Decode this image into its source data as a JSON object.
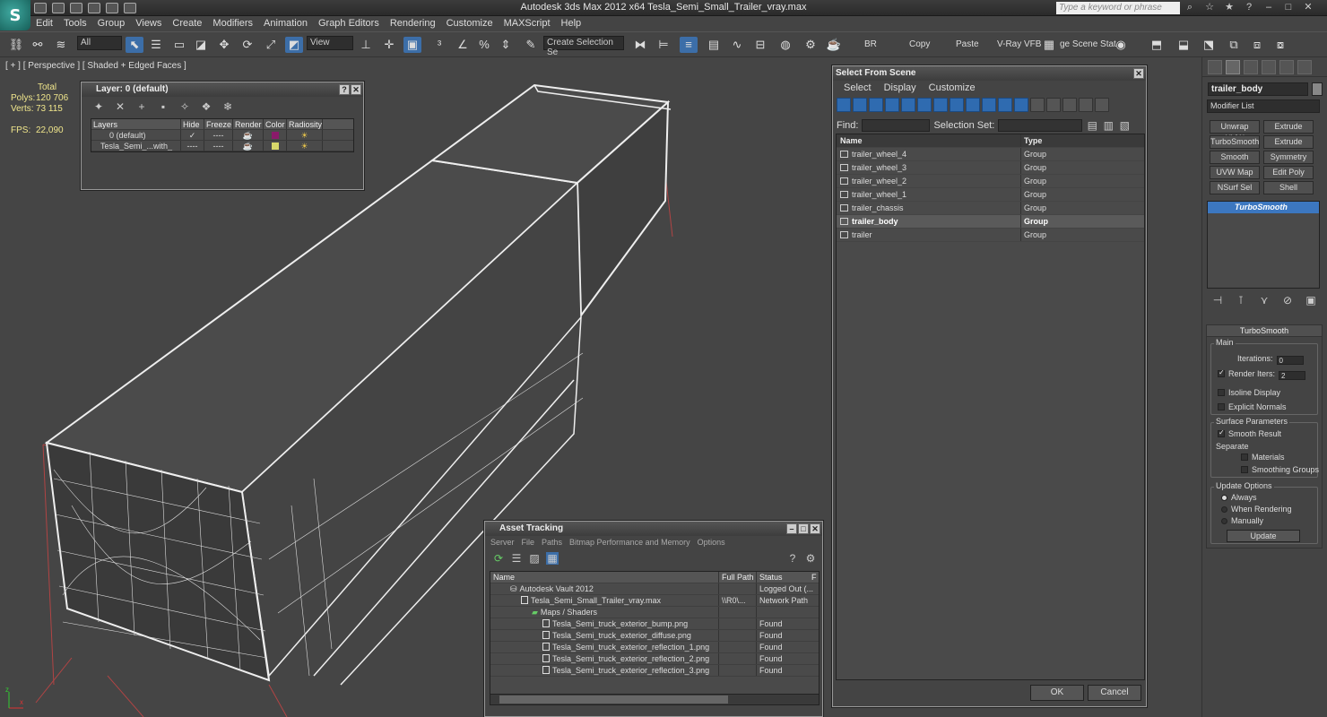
{
  "app": {
    "title": "Autodesk 3ds Max  2012 x64     Tesla_Semi_Small_Trailer_vray.max",
    "search_placeholder": "Type a keyword or phrase",
    "logo_letter": "S"
  },
  "menu": [
    "Edit",
    "Tools",
    "Group",
    "Views",
    "Create",
    "Modifiers",
    "Animation",
    "Graph Editors",
    "Rendering",
    "Customize",
    "MAXScript",
    "Help"
  ],
  "toolbar": {
    "filter": "All",
    "ref_coord": "View",
    "selection_set_placeholder": "Create Selection Se",
    "labels": [
      "BR",
      "Copy",
      "Paste",
      "V-Ray VFB",
      "ge Scene Stat"
    ]
  },
  "viewport": {
    "label": "[ + ] [ Perspective ] [ Shaded + Edged Faces ]",
    "stats": {
      "header": "Total",
      "polys_label": "Polys:",
      "polys": "120 706",
      "verts_label": "Verts:",
      "verts": "73 115",
      "fps_label": "FPS:",
      "fps": "22,090"
    },
    "axis": {
      "x": "x",
      "y": "y",
      "z": "z"
    }
  },
  "layer_panel": {
    "title": "Layer: 0 (default)",
    "columns": [
      "Layers",
      "Hide",
      "Freeze",
      "Render",
      "Color",
      "Radiosity"
    ],
    "rows": [
      {
        "name": "0 (default)",
        "hide": "----",
        "freeze": "----",
        "color": "#8a1a6a"
      },
      {
        "name": "Tesla_Semi_...with_",
        "hide": "----",
        "freeze": "----",
        "color": "#d8d86a"
      }
    ]
  },
  "select_from_scene": {
    "title": "Select From Scene",
    "menu": [
      "Select",
      "Display",
      "Customize"
    ],
    "find_label": "Find:",
    "selection_set_label": "Selection Set:",
    "columns": [
      "Name",
      "Type"
    ],
    "rows": [
      {
        "name": "trailer_wheel_4",
        "type": "Group",
        "selected": false
      },
      {
        "name": "trailer_wheel_3",
        "type": "Group",
        "selected": false
      },
      {
        "name": "trailer_wheel_2",
        "type": "Group",
        "selected": false
      },
      {
        "name": "trailer_wheel_1",
        "type": "Group",
        "selected": false
      },
      {
        "name": "trailer_chassis",
        "type": "Group",
        "selected": false
      },
      {
        "name": "trailer_body",
        "type": "Group",
        "selected": true
      },
      {
        "name": "trailer",
        "type": "Group",
        "selected": false
      }
    ],
    "ok": "OK",
    "cancel": "Cancel"
  },
  "asset_tracking": {
    "title": "Asset Tracking",
    "menu": [
      "Server",
      "File",
      "Paths",
      "Bitmap Performance and Memory",
      "Options"
    ],
    "columns": [
      "Name",
      "Full Path",
      "Status",
      "F"
    ],
    "rows": [
      {
        "indent": 1,
        "name": "Autodesk Vault 2012",
        "path": "",
        "status": "Logged Out (..."
      },
      {
        "indent": 2,
        "name": "Tesla_Semi_Small_Trailer_vray.max",
        "path": "\\\\R0\\...",
        "status": "Network Path"
      },
      {
        "indent": 3,
        "name": "Maps / Shaders",
        "path": "",
        "status": ""
      },
      {
        "indent": 4,
        "name": "Tesla_Semi_truck_exterior_bump.png",
        "path": "",
        "status": "Found"
      },
      {
        "indent": 4,
        "name": "Tesla_Semi_truck_exterior_diffuse.png",
        "path": "",
        "status": "Found"
      },
      {
        "indent": 4,
        "name": "Tesla_Semi_truck_exterior_reflection_1.png",
        "path": "",
        "status": "Found"
      },
      {
        "indent": 4,
        "name": "Tesla_Semi_truck_exterior_reflection_2.png",
        "path": "",
        "status": "Found"
      },
      {
        "indent": 4,
        "name": "Tesla_Semi_truck_exterior_reflection_3.png",
        "path": "",
        "status": "Found"
      }
    ]
  },
  "command_panel": {
    "object_name": "trailer_body",
    "modifier_list": "Modifier List",
    "modifier_buttons": [
      "Unwrap UVW",
      "Extrude",
      "TurboSmooth",
      "Extrude",
      "Smooth",
      "Symmetry",
      "UVW Map",
      "Edit Poly",
      "NSurf Sel",
      "Shell"
    ],
    "stack_item": "TurboSmooth",
    "rollout": {
      "title": "TurboSmooth",
      "main_label": "Main",
      "iterations_label": "Iterations:",
      "iterations": "0",
      "render_iters_label": "Render Iters:",
      "render_iters": "2",
      "isoline": "Isoline Display",
      "explicit": "Explicit Normals",
      "surface_label": "Surface Parameters",
      "smooth_result": "Smooth Result",
      "separate_label": "Separate",
      "materials": "Materials",
      "smoothing_groups": "Smoothing Groups",
      "update_label": "Update Options",
      "always": "Always",
      "when_rendering": "When Rendering",
      "manually": "Manually",
      "update_btn": "Update"
    }
  }
}
